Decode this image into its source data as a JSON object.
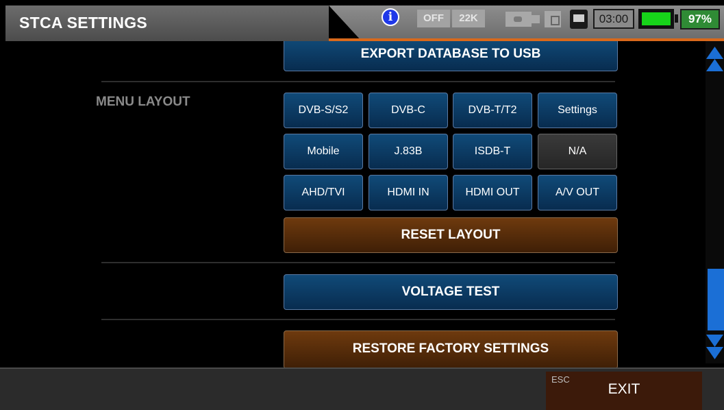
{
  "header": {
    "title": "STCA SETTINGS",
    "status": {
      "info_icon": "i",
      "lnb_power": "OFF",
      "tone": "22K",
      "time": "03:00",
      "battery_percent": "97%",
      "battery_level": 0.97
    }
  },
  "content": {
    "export_button": "EXPORT DATABASE TO USB",
    "menu_layout_label": "MENU LAYOUT",
    "layout_buttons": [
      "DVB-S/S2",
      "DVB-C",
      "DVB-T/T2",
      "Settings",
      "Mobile",
      "J.83B",
      "ISDB-T",
      "N/A",
      "AHD/TVI",
      "HDMI IN",
      "HDMI OUT",
      "A/V OUT"
    ],
    "reset_layout_button": "RESET LAYOUT",
    "voltage_test_button": "VOLTAGE TEST",
    "restore_factory_button": "RESTORE FACTORY SETTINGS"
  },
  "footer": {
    "esc_label": "ESC",
    "exit_label": "EXIT"
  },
  "colors": {
    "accent_orange": "#d9691c",
    "button_blue": "#104a78",
    "button_brown": "#6e3a0e",
    "battery_green": "#17d41a",
    "scroll_blue": "#1b6fd6"
  }
}
